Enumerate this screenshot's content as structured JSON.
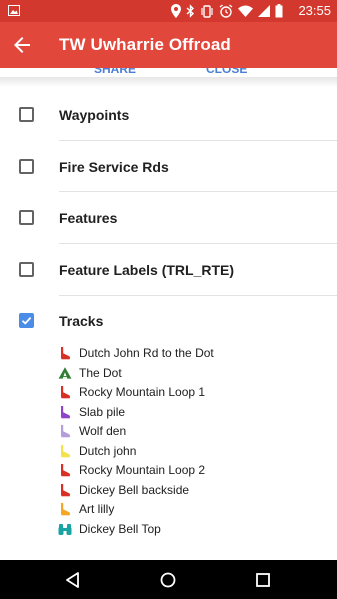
{
  "status_bar": {
    "time": "23:55"
  },
  "app_bar": {
    "title": "TW Uwharrie Offroad"
  },
  "peek_buttons": {
    "share": "SHARE",
    "close": "CLOSE"
  },
  "layers": [
    {
      "label": "Waypoints",
      "checked": false
    },
    {
      "label": "Fire Service Rds",
      "checked": false
    },
    {
      "label": "Features",
      "checked": false
    },
    {
      "label": "Feature Labels (TRL_RTE)",
      "checked": false
    },
    {
      "label": "Tracks",
      "checked": true
    }
  ],
  "tracks": [
    {
      "label": "Dutch John Rd to the Dot",
      "icon": "boot-icon",
      "color": "#d93025"
    },
    {
      "label": "The Dot",
      "icon": "tent-icon",
      "color": "#2e7d32"
    },
    {
      "label": "Rocky Mountain Loop 1",
      "icon": "boot-icon",
      "color": "#d93025"
    },
    {
      "label": "Slab pile",
      "icon": "boot-icon",
      "color": "#8e44c8"
    },
    {
      "label": "Wolf den",
      "icon": "boot-icon",
      "color": "#b39ddb"
    },
    {
      "label": "Dutch john",
      "icon": "boot-icon",
      "color": "#f2e34b"
    },
    {
      "label": "Rocky Mountain Loop 2",
      "icon": "boot-icon",
      "color": "#d93025"
    },
    {
      "label": "Dickey Bell backside",
      "icon": "boot-icon",
      "color": "#d93025"
    },
    {
      "label": "Art lilly",
      "icon": "boot-icon",
      "color": "#f5a623"
    },
    {
      "label": "Dickey Bell Top",
      "icon": "binoculars-icon",
      "color": "#1aa3a3"
    }
  ]
}
